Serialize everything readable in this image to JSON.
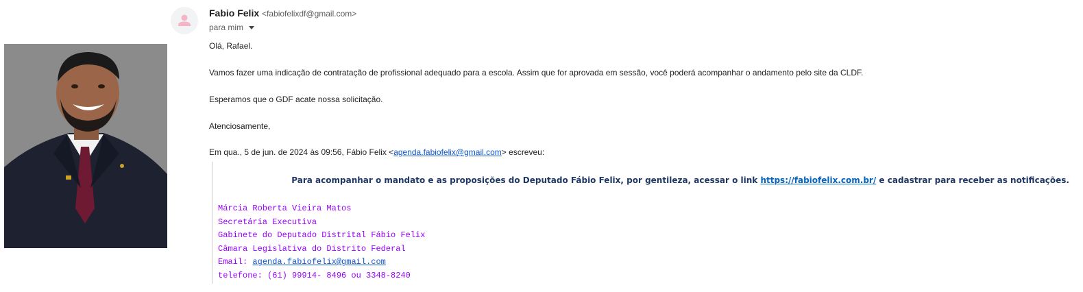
{
  "sender": {
    "name": "Fabio Felix",
    "email": "<fabiofelixdf@gmail.com>"
  },
  "recipient": {
    "label": "para mim"
  },
  "body": {
    "greeting": "Olá, Rafael.",
    "paragraph1": "Vamos fazer uma indicação de contratação de profissional adequado para a escola. Assim que for aprovada em sessão, você poderá acompanhar o andamento pelo site da CLDF.",
    "paragraph2": "Esperamos que o GDF acate nossa solicitação.",
    "closing": "Atenciosamente,"
  },
  "quote_header": {
    "prefix": "Em qua., 5 de jun. de 2024 às 09:56, Fábio Felix <",
    "email_link": "agenda.fabiofelix@gmail.com",
    "suffix": "> escreveu:"
  },
  "notice": {
    "text_before": "Para acompanhar o mandato e as proposições do Deputado Fábio Felix, por gentileza, acessar o link ",
    "link": "https://fabiofelix.com.br/",
    "text_after": " e cadastrar para receber as notificações."
  },
  "signature": {
    "line1": "Márcia Roberta Vieira Matos",
    "line2": "Secretária Executiva",
    "line3": "Gabinete do Deputado Distrital Fábio Felix",
    "line4": "Câmara Legislativa do Distrito Federal",
    "email_label": "Email: ",
    "email_link": "agenda.fabiofelix@gmail.com",
    "phone": "telefone: (61) 99914- 8496 ou 3348-8240"
  },
  "icons": {
    "avatar": "person-icon",
    "recipient_toggle": "caret-down-icon"
  },
  "colors": {
    "link": "#1155cc",
    "signature": "#9900ff",
    "notice": "#1f3864"
  }
}
